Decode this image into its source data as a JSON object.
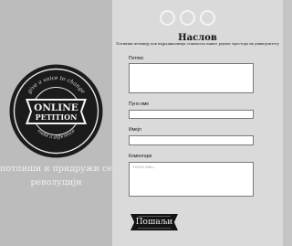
{
  "badge": {
    "main_text_1": "ONLINE",
    "main_text_2": "PETITION",
    "arc_top": "give a voice to change",
    "arc_bottom": "make a difference"
  },
  "sidebar": {
    "tagline_line1": "потпиши и придружи се",
    "tagline_line2": "револуцији"
  },
  "form": {
    "title": "Наслов",
    "subtitle": "Потпиши петицију док најрадикалнија ставопоља нашег радног простора на универзитету",
    "fields": {
      "signature_label": "Потпис",
      "fullname_label": "Пуно име",
      "email_label": "Имејл",
      "comments_label": "Коментари",
      "comments_placeholder": "Унеси наш..."
    },
    "submit_label": "Пошаљи"
  },
  "colors": {
    "left_bg": "#bcbcbc",
    "right_bg": "#dadada",
    "badge_dark": "#1b1b1b",
    "button_bg": "#141414"
  }
}
